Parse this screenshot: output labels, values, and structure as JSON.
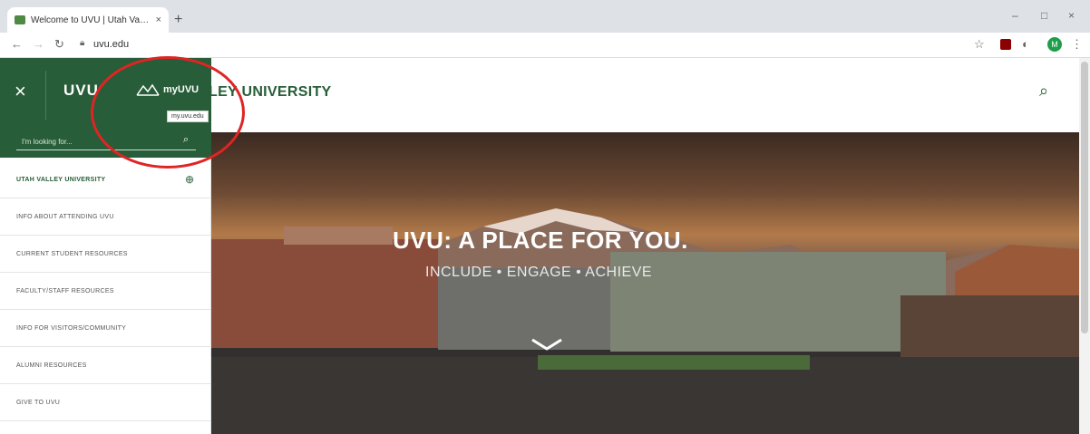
{
  "browser": {
    "tab_title": "Welcome to UVU | Utah Valley U",
    "tab_close": "×",
    "new_tab": "+",
    "url": "uvu.edu",
    "controls": {
      "minimize": "–",
      "maximize": "□",
      "close": "×"
    },
    "avatar_letter": "M"
  },
  "site": {
    "name": "LEY UNIVERSITY"
  },
  "sidebar": {
    "close_label": "×",
    "logo": "UVU",
    "myuvu_label": "myUVU",
    "tooltip": "my.uvu.edu",
    "search_placeholder": "I'm looking for...",
    "menu_items": [
      {
        "label": "UTAH VALLEY UNIVERSITY"
      },
      {
        "label": "INFO ABOUT ATTENDING UVU"
      },
      {
        "label": "CURRENT STUDENT RESOURCES"
      },
      {
        "label": "FACULTY/STAFF RESOURCES"
      },
      {
        "label": "INFO FOR VISITORS/COMMUNITY"
      },
      {
        "label": "ALUMNI RESOURCES"
      },
      {
        "label": "GIVE TO UVU"
      }
    ]
  },
  "hero": {
    "title": "UVU: A PLACE FOR YOU.",
    "subtitle": "INCLUDE • ENGAGE • ACHIEVE"
  },
  "colors": {
    "brand_green": "#275d38",
    "annotation_red": "#e02424"
  }
}
